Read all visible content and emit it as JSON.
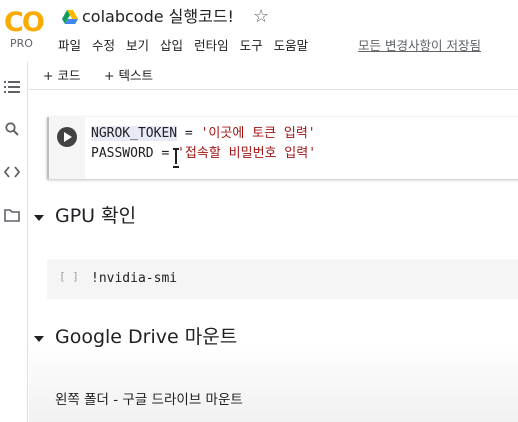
{
  "app": {
    "logo_text": "CO",
    "logo_badge": "PRO",
    "title": "colabcode 실행코드!"
  },
  "menu": {
    "items": [
      "파일",
      "수정",
      "보기",
      "삽입",
      "런타임",
      "도구",
      "도움말"
    ],
    "save_status": "모든 변경사항이 저장됨"
  },
  "toolbar": {
    "add_code": "+ 코드",
    "add_text": "+ 텍스트"
  },
  "cells": {
    "code1": {
      "line1": {
        "var": "NGROK_TOKEN",
        "op": " = ",
        "str": "'이곳에 토큰 입력'"
      },
      "line2": {
        "var": "PASSWORD",
        "op": " = ",
        "str": "'접속할 비밀번호 입력'"
      }
    },
    "section1": {
      "title": "GPU 확인"
    },
    "code2": {
      "bracket": "[ ]",
      "code": "!nvidia-smi"
    },
    "section2": {
      "title": "Google Drive 마운트"
    },
    "text1": {
      "content": "왼쪽 폴더 - 구글 드라이브 마운트"
    }
  },
  "icons": {
    "logo": "colab-logo-icon",
    "drive": "google-drive-icon",
    "star": "star-icon",
    "toc": "table-of-contents-icon",
    "search": "search-icon",
    "snippets": "code-snippets-icon",
    "files": "folder-icon",
    "run": "play-icon",
    "collapse": "caret-down-icon",
    "cursor": "text-cursor-icon"
  },
  "colors": {
    "logo_orange": "#f9ab00",
    "string": "#a31515",
    "text": "#202124",
    "muted": "#5f6368"
  }
}
